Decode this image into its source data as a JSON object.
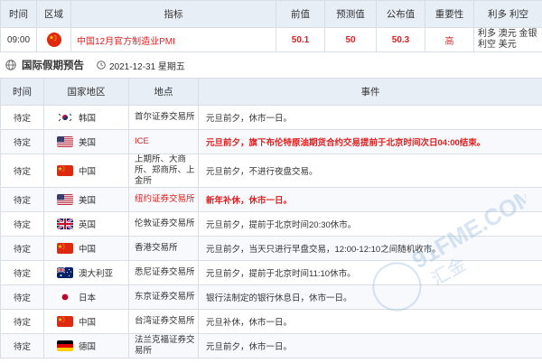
{
  "top_table": {
    "headers": [
      "时间",
      "区域",
      "指标",
      "前值",
      "预测值",
      "公布值",
      "重要性",
      "利多 利空"
    ],
    "row": {
      "time": "09:00",
      "indicator": "中国12月官方制造业PMI",
      "prev": "50.1",
      "forecast": "50",
      "actual": "50.3",
      "importance": "高",
      "bullish_line": "利多 澳元 金银",
      "bearish_line": "利空 美元"
    }
  },
  "section": {
    "title": "国际假期预告",
    "date": "2021-12-31 星期五"
  },
  "holiday_table": {
    "headers": [
      "时间",
      "国家地区",
      "地点",
      "事件"
    ],
    "rows": [
      {
        "time": "待定",
        "flag": "kr",
        "country": "韩国",
        "place": "首尔证券交易所",
        "event": "元旦前夕，休市一日。",
        "highlight": false
      },
      {
        "time": "待定",
        "flag": "us",
        "country": "美国",
        "place": "ICE",
        "event": "元旦前夕，旗下布伦特原油期货合约交易提前于北京时间次日04:00结束。",
        "highlight": true
      },
      {
        "time": "待定",
        "flag": "cn",
        "country": "中国",
        "place": "上期所、大商所、郑商所、上金所",
        "event": "元旦前夕，不进行夜盘交易。",
        "highlight": false
      },
      {
        "time": "待定",
        "flag": "us",
        "country": "美国",
        "place": "纽约证券交易所",
        "event": "新年补休，休市一日。",
        "highlight": true
      },
      {
        "time": "待定",
        "flag": "gb",
        "country": "英国",
        "place": "伦敦证券交易所",
        "event": "元旦前夕，提前于北京时间20:30休市。",
        "highlight": false
      },
      {
        "time": "待定",
        "flag": "cn",
        "country": "中国",
        "place": "香港交易所",
        "event": "元旦前夕，当天只进行早盘交易，12:00-12:10之间随机收市。",
        "highlight": false
      },
      {
        "time": "待定",
        "flag": "au",
        "country": "澳大利亚",
        "place": "悉尼证券交易所",
        "event": "元旦前夕，提前于北京时间11:10休市。",
        "highlight": false
      },
      {
        "time": "待定",
        "flag": "jp",
        "country": "日本",
        "place": "东京证券交易所",
        "event": "银行法制定的银行休息日，休市一日。",
        "highlight": false
      },
      {
        "time": "待定",
        "flag": "cn",
        "country": "中国",
        "place": "台湾证券交易所",
        "event": "元旦补休，休市一日。",
        "highlight": false
      },
      {
        "time": "待定",
        "flag": "de",
        "country": "德国",
        "place": "法兰克福证券交易所",
        "event": "元旦前夕，休市一日。",
        "highlight": false
      }
    ]
  },
  "colors": {
    "accent_red": "#e02020",
    "header_bg": "#e8eef6",
    "border": "#d9dee5"
  },
  "icons": {
    "globe": "globe-icon",
    "clock": "clock-icon"
  }
}
